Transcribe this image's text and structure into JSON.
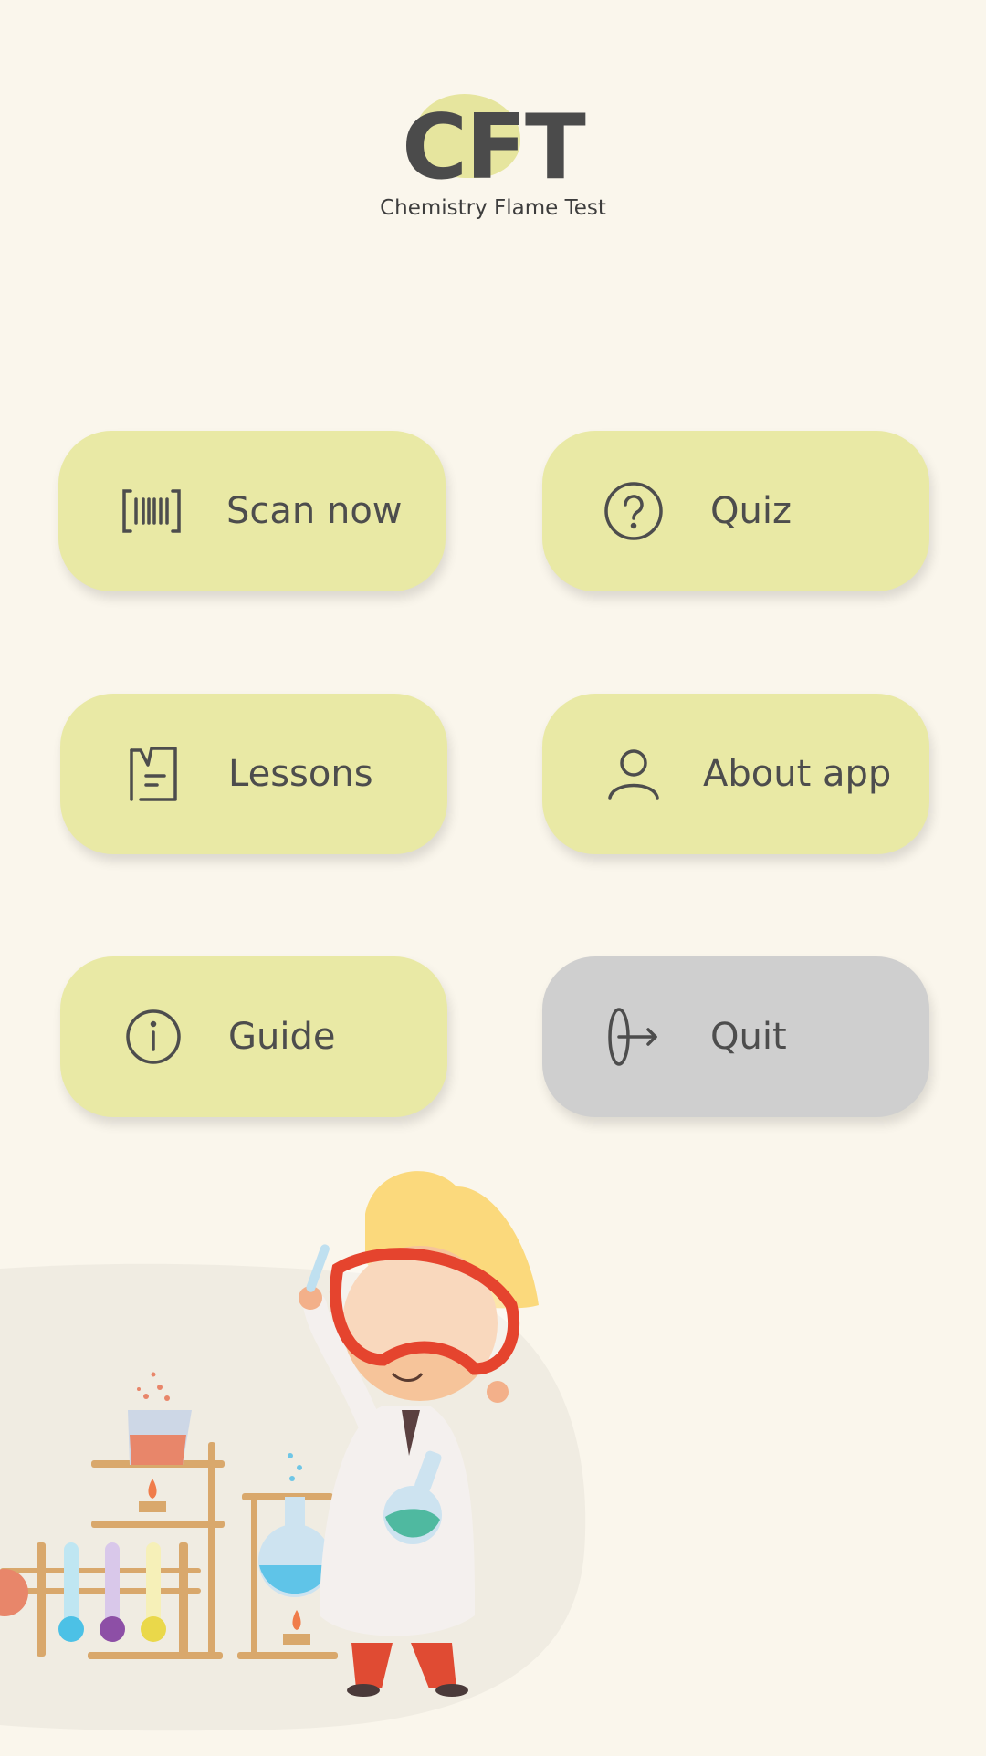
{
  "header": {
    "logo_text": "CFT",
    "subtitle": "Chemistry Flame Test"
  },
  "menu": {
    "scan": {
      "label": "Scan now",
      "icon": "barcode-scan-icon"
    },
    "quiz": {
      "label": "Quiz",
      "icon": "question-circle-icon"
    },
    "lessons": {
      "label": "Lessons",
      "icon": "document-icon"
    },
    "about": {
      "label": "About app",
      "icon": "user-icon"
    },
    "guide": {
      "label": "Guide",
      "icon": "info-circle-icon"
    },
    "quit": {
      "label": "Quit",
      "icon": "exit-icon"
    }
  },
  "colors": {
    "background": "#faf6ec",
    "button": "#e9e9a5",
    "quit_button": "#cfcfcf",
    "text": "#4d4d4d"
  }
}
